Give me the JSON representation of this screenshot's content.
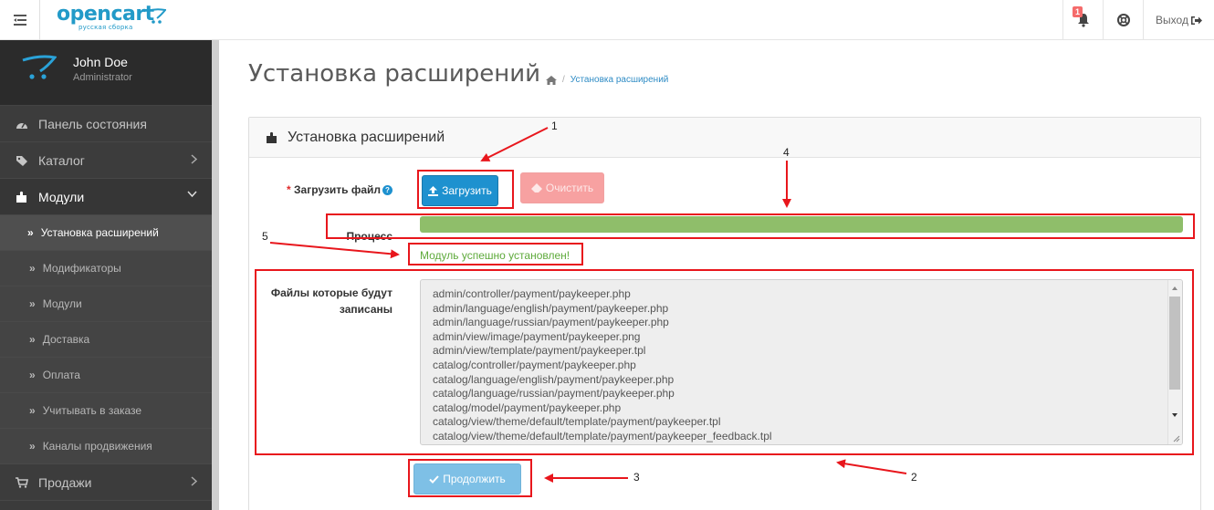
{
  "header": {
    "logo_text": "opencart",
    "logo_sub": "русская сборка",
    "badge_count": "1",
    "logout_label": "Выход"
  },
  "profile": {
    "name": "John Doe",
    "role": "Administrator"
  },
  "nav": {
    "dashboard": "Панель состояния",
    "catalog": "Каталог",
    "modules": "Модули",
    "sales": "Продажи",
    "sub": [
      "Установка расширений",
      "Модификаторы",
      "Модули",
      "Доставка",
      "Оплата",
      "Учитывать в заказе",
      "Каналы продвижения"
    ]
  },
  "page": {
    "title": "Установка расширений",
    "breadcrumb": "Установка расширений",
    "panel_title": "Установка расширений"
  },
  "form": {
    "upload_label": "Загрузить файл",
    "upload_button": "Загрузить",
    "clear_button": "Очистить",
    "progress_label": "Процесс",
    "progress": 1.0,
    "success_text": "Модуль успешно установлен!",
    "files_label_1": "Файлы которые будут",
    "files_label_2": "записаны",
    "files": [
      "admin/controller/payment/paykeeper.php",
      "admin/language/english/payment/paykeeper.php",
      "admin/language/russian/payment/paykeeper.php",
      "admin/view/image/payment/paykeeper.png",
      "admin/view/template/payment/paykeeper.tpl",
      "catalog/controller/payment/paykeeper.php",
      "catalog/language/english/payment/paykeeper.php",
      "catalog/language/russian/payment/paykeeper.php",
      "catalog/model/payment/paykeeper.php",
      "catalog/view/theme/default/template/payment/paykeeper.tpl",
      "catalog/view/theme/default/template/payment/paykeeper_feedback.tpl"
    ],
    "continue_button": "Продолжить"
  },
  "annotations": [
    "1",
    "2",
    "3",
    "4",
    "5"
  ],
  "colors": {
    "accent": "#1e91cf",
    "annotation": "#e8161c",
    "success": "#5eaa3b",
    "progress": "#8fbe6a"
  }
}
